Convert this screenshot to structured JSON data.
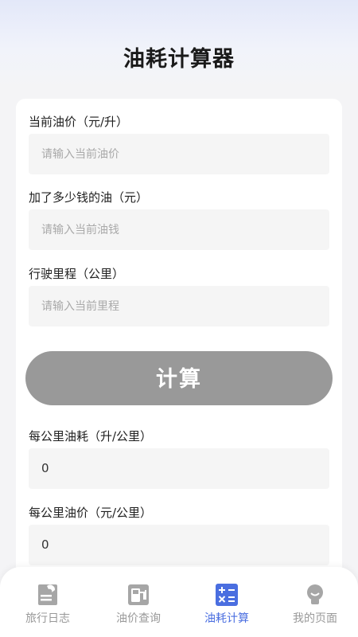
{
  "page": {
    "title": "油耗计算器"
  },
  "form": {
    "price_label": "当前油价（元/升）",
    "price_placeholder": "请输入当前油价",
    "money_label": "加了多少钱的油（元）",
    "money_placeholder": "请输入当前油钱",
    "distance_label": "行驶里程（公里）",
    "distance_placeholder": "请输入当前里程",
    "calc_button": "计算"
  },
  "results": {
    "consumption_label": "每公里油耗（升/公里）",
    "consumption_value": "0",
    "cost_label": "每公里油价（元/公里）",
    "cost_value": "0"
  },
  "tabbar": {
    "items": [
      {
        "label": "旅行日志",
        "icon": "journal-icon",
        "active": false
      },
      {
        "label": "油价查询",
        "icon": "fuel-pump-icon",
        "active": false
      },
      {
        "label": "油耗计算",
        "icon": "calculator-icon",
        "active": true
      },
      {
        "label": "我的页面",
        "icon": "profile-icon",
        "active": false
      }
    ]
  },
  "colors": {
    "accent": "#4a6ee0",
    "inactive": "#999999",
    "button": "#999999"
  }
}
